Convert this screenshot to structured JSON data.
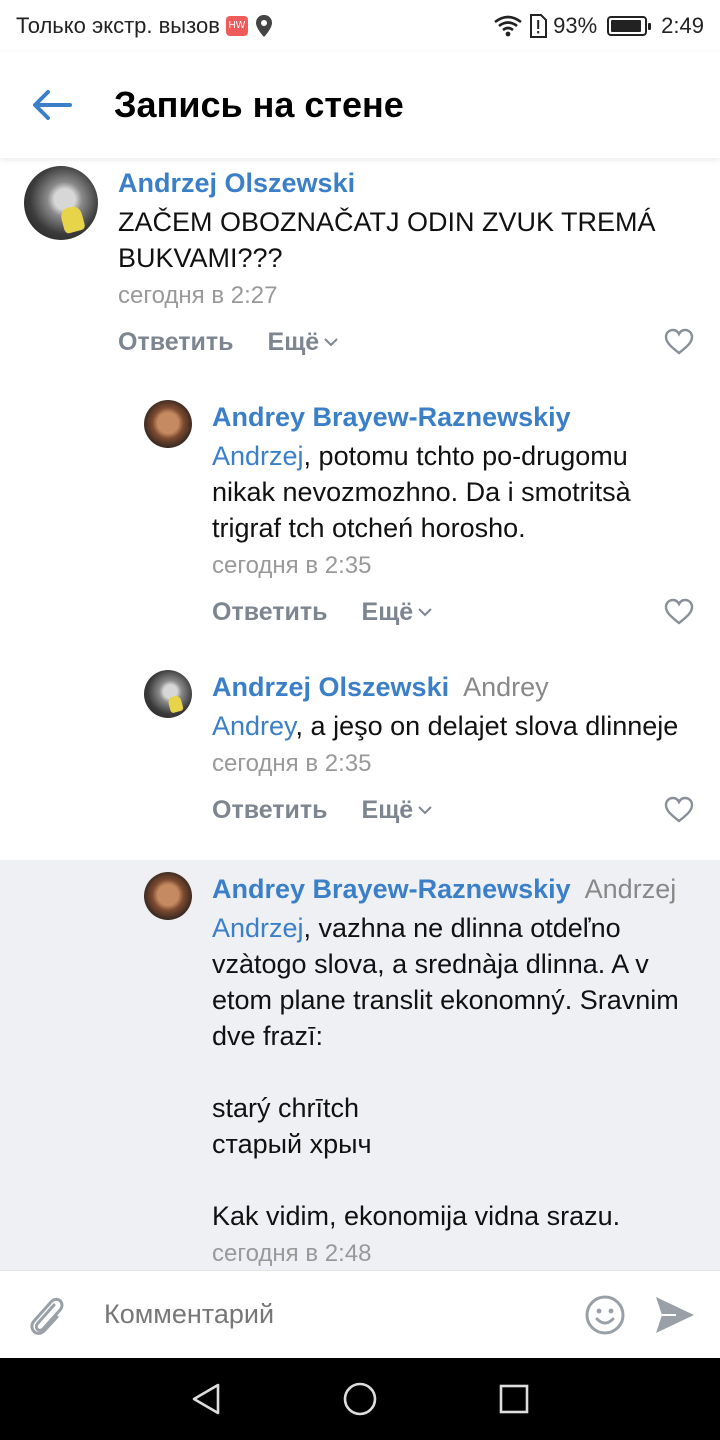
{
  "statusbar": {
    "carrier": "Только экстр. вызов",
    "battery": "93%",
    "battery_level": 0.93,
    "time": "2:49"
  },
  "header": {
    "title": "Запись на стене"
  },
  "actions": {
    "reply": "Ответить",
    "more": "Ещё"
  },
  "comments": [
    {
      "author": "Andrzej Olszewski",
      "reply_to": "",
      "mention": "",
      "text": "ZAČEM OBOZNAČATJ ODIN ZVUK TREMÁ BUKVAMI???",
      "time": "сегодня в 2:27",
      "avatar": "bird-avatar"
    },
    {
      "author": "Andrey Brayew-Raznewskiy",
      "reply_to": "",
      "mention": "Andrzej",
      "text": ", potomu tchto po-drugomu nikak nevozmozhno. Da i smotritsà trigraf tch otcheń horosho.",
      "time": "сегодня в 2:35",
      "avatar": "man-avatar"
    },
    {
      "author": "Andrzej Olszewski",
      "reply_to": "Andrey",
      "mention": "Andrey",
      "text": ", a jeşo on delajet slova dlinneje",
      "time": "сегодня в 2:35",
      "avatar": "bird-avatar"
    },
    {
      "author": "Andrey Brayew-Raznewskiy",
      "reply_to": "Andrzej",
      "mention": "Andrzej",
      "text": ", vazhna ne dlinna otdeľno vzàtogo slova, a srednàja dlinna. A v etom plane translit ekonomný. Sravnim dve frazī:\n\nstarý chrītch\nстарый хрыч\n\nKak vidim, ekonomija vidna srazu.",
      "time": "сегодня в 2:48",
      "avatar": "man-avatar"
    }
  ],
  "composer": {
    "placeholder": "Комментарий"
  },
  "colors": {
    "accent": "#3a7fc8",
    "highlight": "#eef0f3",
    "muted": "#999999"
  }
}
